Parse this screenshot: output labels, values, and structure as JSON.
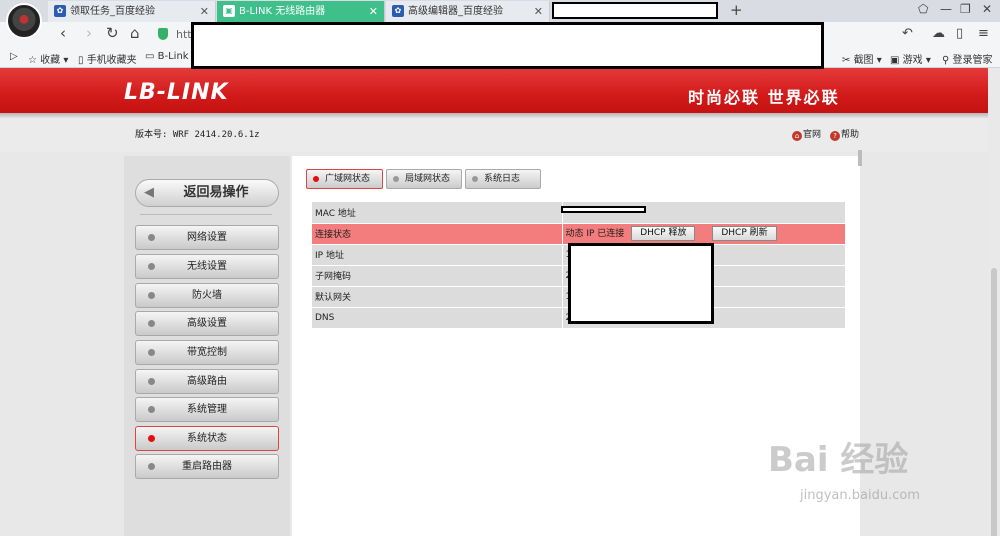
{
  "browser": {
    "tabs": [
      {
        "label": "领取任务_百度经验",
        "active": false
      },
      {
        "label": "B-LINK 无线路由器",
        "active": true
      },
      {
        "label": "高级编辑器_百度经验",
        "active": false
      }
    ],
    "url_prefix": "htt",
    "bookmarks": {
      "favorites": "收藏",
      "mobile": "手机收藏夹",
      "blink": "B-Link",
      "screenshot": "截图",
      "games": "游戏",
      "login": "登录管家"
    }
  },
  "header": {
    "logo": "LB-LINK",
    "slogan": "时尚必联  世界必联"
  },
  "version": "版本号: WRF 2414.20.6.1z",
  "toplinks": {
    "official": "官网",
    "help": "帮助"
  },
  "sidebar": {
    "back_label": "返回易操作",
    "items": [
      {
        "label": "网络设置",
        "active": false
      },
      {
        "label": "无线设置",
        "active": false
      },
      {
        "label": "防火墙",
        "active": false
      },
      {
        "label": "高级设置",
        "active": false
      },
      {
        "label": "带宽控制",
        "active": false
      },
      {
        "label": "高级路由",
        "active": false
      },
      {
        "label": "系统管理",
        "active": false
      },
      {
        "label": "系统状态",
        "active": true
      },
      {
        "label": "重启路由器",
        "active": false
      }
    ]
  },
  "content_tabs": [
    {
      "label": "广域网状态",
      "active": true
    },
    {
      "label": "局域网状态",
      "active": false
    },
    {
      "label": "系统日志",
      "active": false
    }
  ],
  "wan_status": {
    "rows": [
      {
        "key": "MAC 地址",
        "value": ""
      },
      {
        "key": "连接状态",
        "value": "动态 IP 已连接"
      },
      {
        "key": "IP 地址",
        "value": "1"
      },
      {
        "key": "子网掩码",
        "value": "2"
      },
      {
        "key": "默认网关",
        "value": "1"
      },
      {
        "key": "DNS",
        "value": "2"
      }
    ],
    "dhcp_release": "DHCP 释放",
    "dhcp_renew": "DHCP 刷新"
  },
  "watermark": {
    "main": "Bai 经验",
    "sub": "jingyan.baidu.com"
  },
  "colors": {
    "accent_red": "#d21a1a",
    "active_tab": "#3fbf8a",
    "highlight_row": "#f37c7c"
  }
}
